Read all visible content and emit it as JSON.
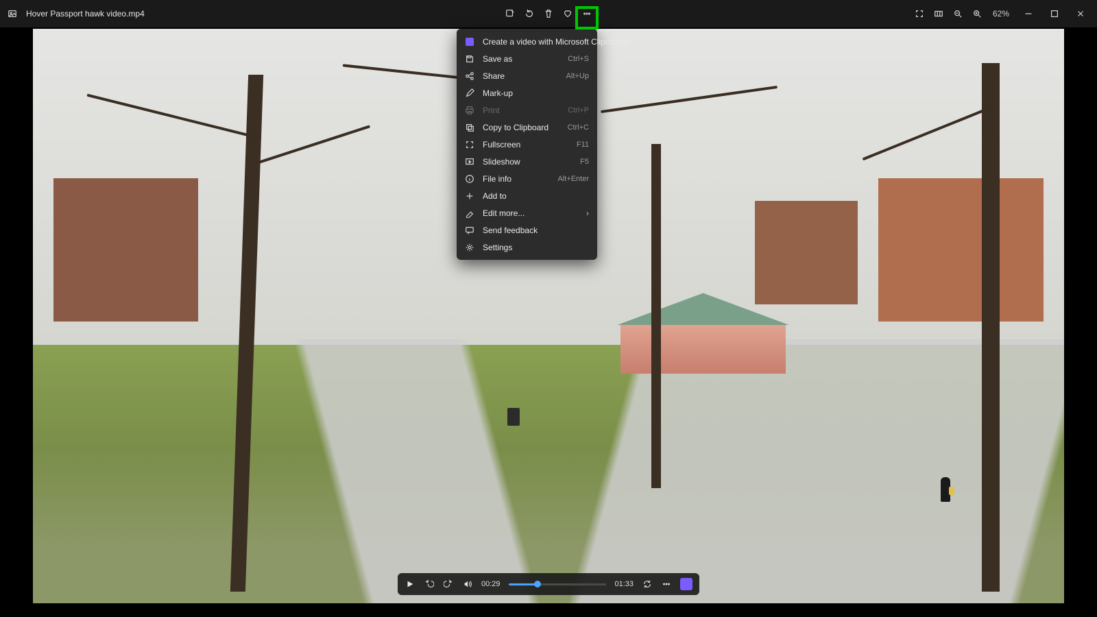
{
  "titlebar": {
    "filename": "Hover Passport hawk video.mp4",
    "zoom": "62%"
  },
  "menu": {
    "items": [
      {
        "label": "Create a video with Microsoft Clipchamp",
        "shortcut": "",
        "icon": "clipchamp"
      },
      {
        "label": "Save as",
        "shortcut": "Ctrl+S",
        "icon": "save"
      },
      {
        "label": "Share",
        "shortcut": "Alt+Up",
        "icon": "share"
      },
      {
        "label": "Mark-up",
        "shortcut": "",
        "icon": "markup"
      },
      {
        "label": "Print",
        "shortcut": "Ctrl+P",
        "icon": "print",
        "disabled": true
      },
      {
        "label": "Copy to Clipboard",
        "shortcut": "Ctrl+C",
        "icon": "copy"
      },
      {
        "label": "Fullscreen",
        "shortcut": "F11",
        "icon": "fullscreen"
      },
      {
        "label": "Slideshow",
        "shortcut": "F5",
        "icon": "slideshow"
      },
      {
        "label": "File info",
        "shortcut": "Alt+Enter",
        "icon": "info"
      },
      {
        "label": "Add to",
        "shortcut": "",
        "icon": "add"
      },
      {
        "label": "Edit more...",
        "shortcut": "",
        "icon": "edit",
        "submenu": true
      },
      {
        "label": "Send feedback",
        "shortcut": "",
        "icon": "feedback"
      },
      {
        "label": "Settings",
        "shortcut": "",
        "icon": "settings"
      }
    ]
  },
  "playback": {
    "current": "00:29",
    "total": "01:33",
    "progress_pct": 30
  }
}
